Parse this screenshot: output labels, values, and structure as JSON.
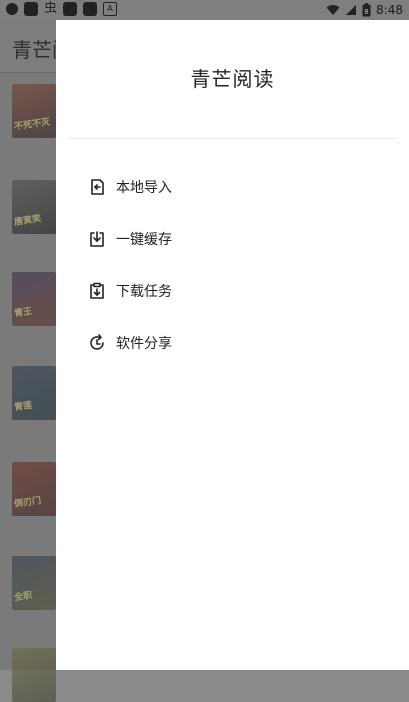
{
  "status_bar": {
    "time": "8:48",
    "left_glyph": "虫",
    "badge_letter": "A",
    "battery_level": "8"
  },
  "background_app": {
    "title": "青芒阅读",
    "book_covers": [
      {
        "text": "不死不灭",
        "top_color": "#7a3a2a",
        "bottom_color": "#2a1a1a"
      },
      {
        "text": "唐寅笑",
        "top_color": "#4a4a4a",
        "bottom_color": "#1a1a1a"
      },
      {
        "text": "青王",
        "top_color": "#3a2a4a",
        "bottom_color": "#5a2a1a"
      },
      {
        "text": "青莲",
        "top_color": "#2a3a4a",
        "bottom_color": "#1a2a3a"
      },
      {
        "text": "倒刃门",
        "top_color": "#6a2a1a",
        "bottom_color": "#3a1a1a"
      },
      {
        "text": "全职",
        "top_color": "#2a3a4a",
        "bottom_color": "#4a4a2a"
      },
      {
        "text": "",
        "top_color": "#6a6a3a",
        "bottom_color": "#3a3a2a"
      }
    ]
  },
  "drawer": {
    "title": "青芒阅读",
    "menu": [
      {
        "label": "本地导入",
        "icon": "import-icon"
      },
      {
        "label": "一键缓存",
        "icon": "cache-icon"
      },
      {
        "label": "下载任务",
        "icon": "download-icon"
      },
      {
        "label": "软件分享",
        "icon": "share-icon"
      }
    ]
  }
}
